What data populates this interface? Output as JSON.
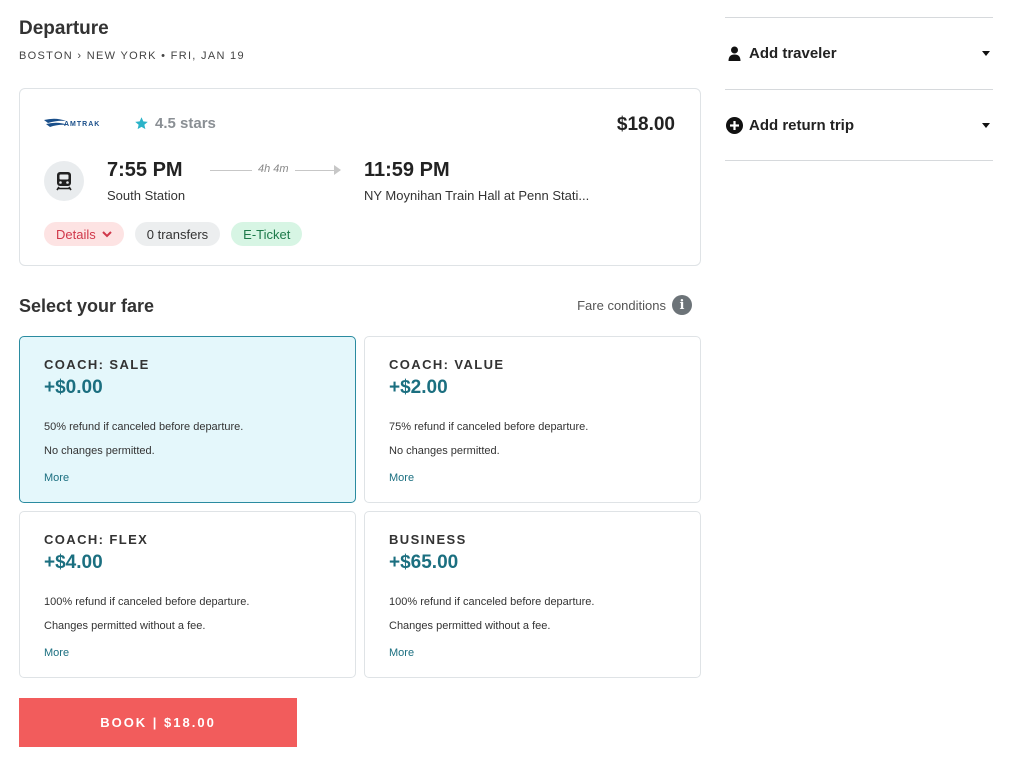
{
  "header": {
    "title": "Departure",
    "route": "BOSTON › NEW YORK • FRI, JAN 19"
  },
  "trip": {
    "operator": "AMTRAK",
    "rating": "4.5 stars",
    "price": "$18.00",
    "departure_time": "7:55 PM",
    "departure_station": "South Station",
    "duration": "4h 4m",
    "arrival_time": "11:59 PM",
    "arrival_station": "NY Moynihan Train Hall at Penn Stati...",
    "chips": {
      "details": "Details",
      "transfers": "0 transfers",
      "ticket": "E-Ticket"
    }
  },
  "fares": {
    "heading": "Select your fare",
    "conditions_label": "Fare conditions",
    "options": [
      {
        "name": "COACH: SALE",
        "price": "+$0.00",
        "line1": "50% refund if canceled before departure.",
        "line2": "No changes permitted.",
        "more": "More"
      },
      {
        "name": "COACH: VALUE",
        "price": "+$2.00",
        "line1": "75% refund if canceled before departure.",
        "line2": "No changes permitted.",
        "more": "More"
      },
      {
        "name": "COACH: FLEX",
        "price": "+$4.00",
        "line1": "100% refund if canceled before departure.",
        "line2": "Changes permitted without a fee.",
        "more": "More"
      },
      {
        "name": "BUSINESS",
        "price": "+$65.00",
        "line1": "100% refund if canceled before departure.",
        "line2": "Changes permitted without a fee.",
        "more": "More"
      }
    ]
  },
  "book_button": "BOOK | $18.00",
  "sidebar": {
    "add_traveler": "Add traveler",
    "add_return_trip": "Add return trip"
  },
  "colors": {
    "accent": "#1b6f80",
    "book": "#f25c5c",
    "selected_fare_bg": "#e4f7fb",
    "star": "#2bb3c8"
  }
}
